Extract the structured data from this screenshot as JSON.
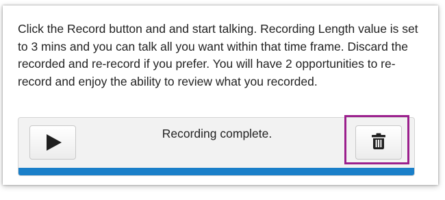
{
  "instructions": {
    "text": "Click the Record button and and start talking. Recording Length value is set to 3 mins and you can talk all you want within that time frame. Discard the recorded and re-record if you prefer. You will have 2 opportunities to re-record and enjoy the ability to review what you recorded."
  },
  "recorder": {
    "status": "Recording complete.",
    "play_icon": "play-icon",
    "delete_icon": "trash-icon",
    "progress_fraction": 1.0
  },
  "colors": {
    "progress": "#1a7fc9",
    "highlight": "#9b1f8d"
  }
}
